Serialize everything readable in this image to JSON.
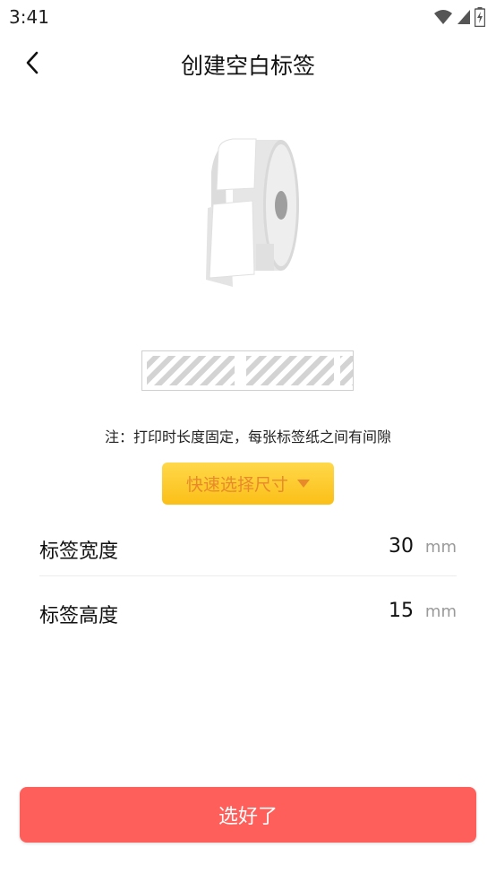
{
  "status_bar": {
    "time": "3:41",
    "icons": [
      "wifi-icon",
      "cellular-signal-icon",
      "battery-charging-icon"
    ]
  },
  "header": {
    "title": "创建空白标签",
    "back_icon": "chevron-left-icon"
  },
  "note": "注：打印时长度固定，每张标签纸之间有间隙",
  "quick_select": {
    "label": "快速选择尺寸",
    "icon": "caret-down-icon"
  },
  "fields": {
    "width": {
      "label": "标签宽度",
      "value": "30",
      "unit": "mm"
    },
    "height": {
      "label": "标签高度",
      "value": "15",
      "unit": "mm"
    }
  },
  "confirm_button": {
    "label": "选好了"
  },
  "colors": {
    "confirm_bg": "#ff5f5a",
    "quick_select_bg": "#fbbf17",
    "quick_select_text": "#e8892b"
  }
}
